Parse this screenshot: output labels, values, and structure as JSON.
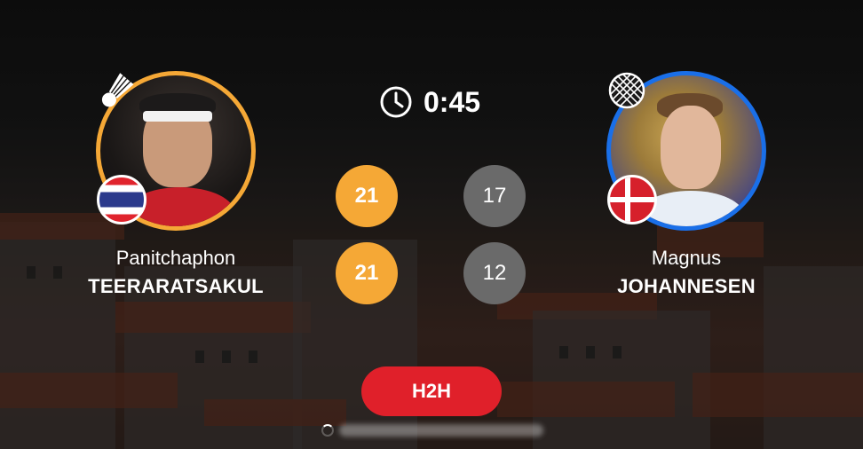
{
  "match": {
    "duration": "0:45",
    "h2h_label": "H2H",
    "colors": {
      "winner_accent": "#f5a836",
      "loser_grey": "#6a6a6a",
      "home_ring": "#f5a836",
      "away_ring": "#1a6fe8",
      "h2h_red": "#e0202a"
    }
  },
  "player_left": {
    "first_name": "Panitchaphon",
    "last_name": "TEERARATSAKUL",
    "country_flag": "thailand-flag",
    "serve_icon": "shuttlecock-icon"
  },
  "player_right": {
    "first_name": "Magnus",
    "last_name": "JOHANNESEN",
    "country_flag": "denmark-flag",
    "side_icon": "racket-icon"
  },
  "scores": [
    {
      "game": 1,
      "left": "21",
      "right": "17"
    },
    {
      "game": 2,
      "left": "21",
      "right": "12"
    }
  ]
}
